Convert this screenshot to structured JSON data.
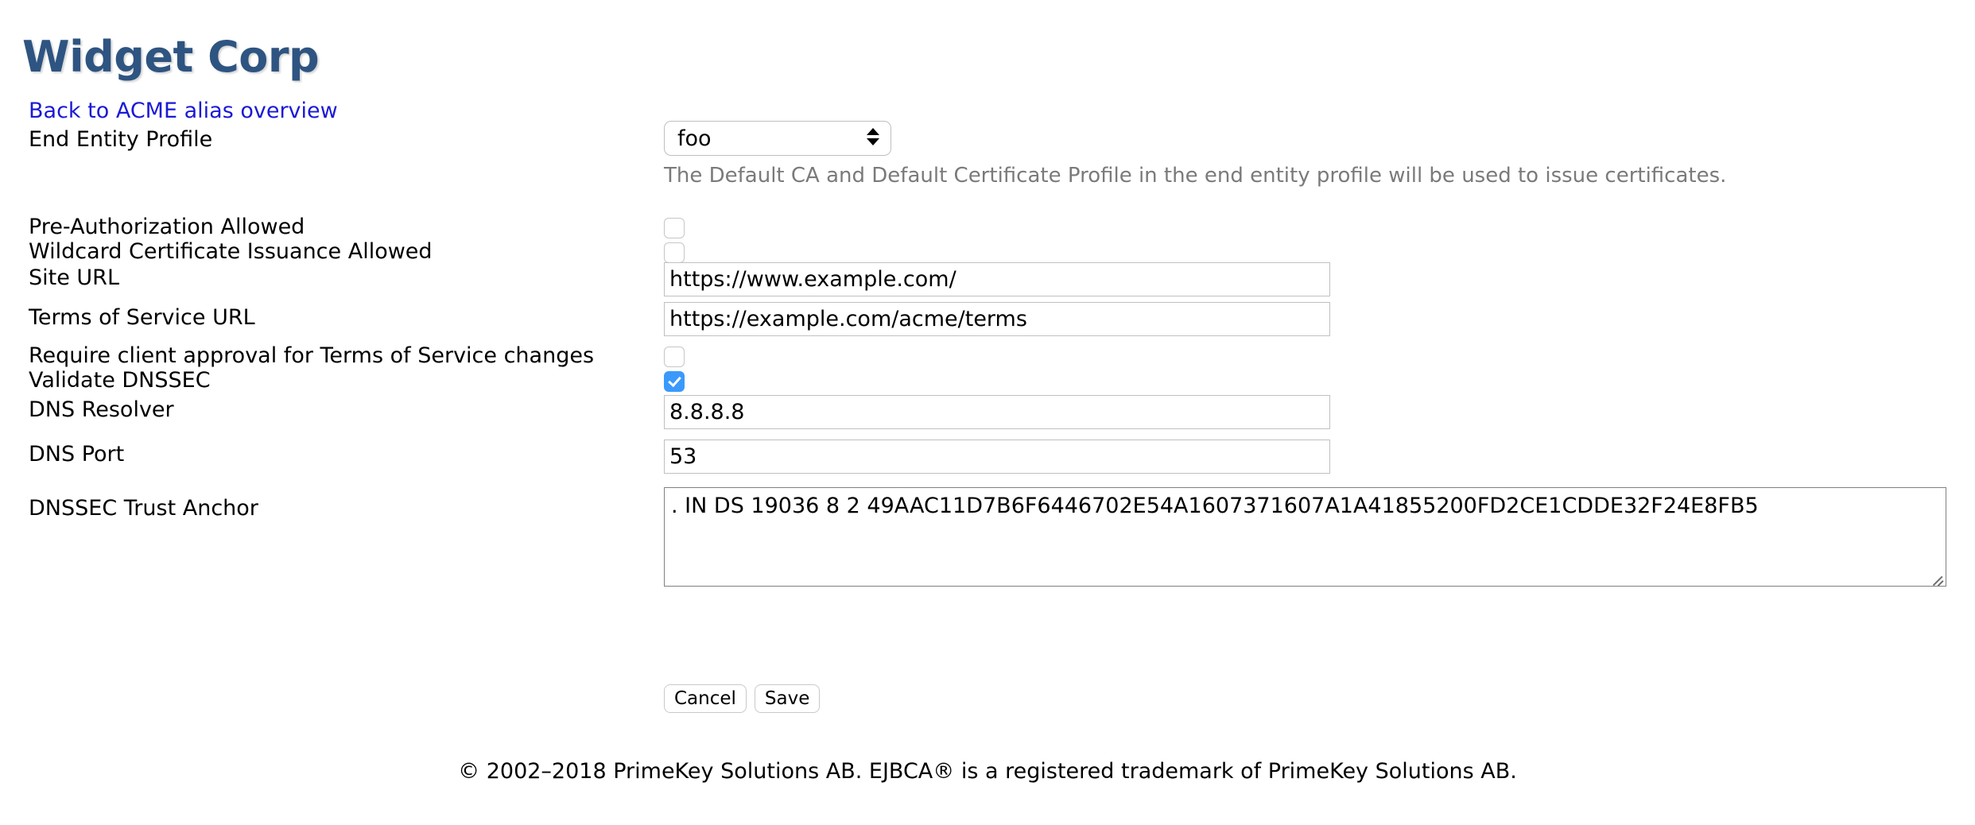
{
  "header": {
    "title": "Widget Corp"
  },
  "nav": {
    "back_link": "Back to ACME alias overview"
  },
  "form": {
    "end_entity_profile": {
      "label": "End Entity Profile",
      "value": "foo",
      "help": "The Default CA and Default Certificate Profile in the end entity profile will be used to issue certificates."
    },
    "pre_authorization": {
      "label": "Pre-Authorization Allowed",
      "checked": false
    },
    "wildcard_issuance": {
      "label": "Wildcard Certificate Issuance Allowed",
      "checked": false
    },
    "site_url": {
      "label": "Site URL",
      "value": "https://www.example.com/"
    },
    "terms_url": {
      "label": "Terms of Service URL",
      "value": "https://example.com/acme/terms"
    },
    "require_approval": {
      "label": "Require client approval for Terms of Service changes",
      "checked": false
    },
    "validate_dnssec": {
      "label": "Validate DNSSEC",
      "checked": true
    },
    "dns_resolver": {
      "label": "DNS Resolver",
      "value": "8.8.8.8"
    },
    "dns_port": {
      "label": "DNS Port",
      "value": "53"
    },
    "dnssec_trust_anchor": {
      "label": "DNSSEC Trust Anchor",
      "value": ". IN DS 19036 8 2 49AAC11D7B6F6446702E54A1607371607A1A41855200FD2CE1CDDE32F24E8FB5"
    }
  },
  "actions": {
    "cancel_label": "Cancel",
    "save_label": "Save"
  },
  "footer": {
    "copyright": "© 2002–2018 PrimeKey Solutions AB. EJBCA® is a registered trademark of PrimeKey Solutions AB."
  },
  "colors": {
    "title": "#2e5481",
    "link": "#1a19d6",
    "checkbox_checked": "#3b99fc",
    "help_text": "#7a7a7a"
  }
}
